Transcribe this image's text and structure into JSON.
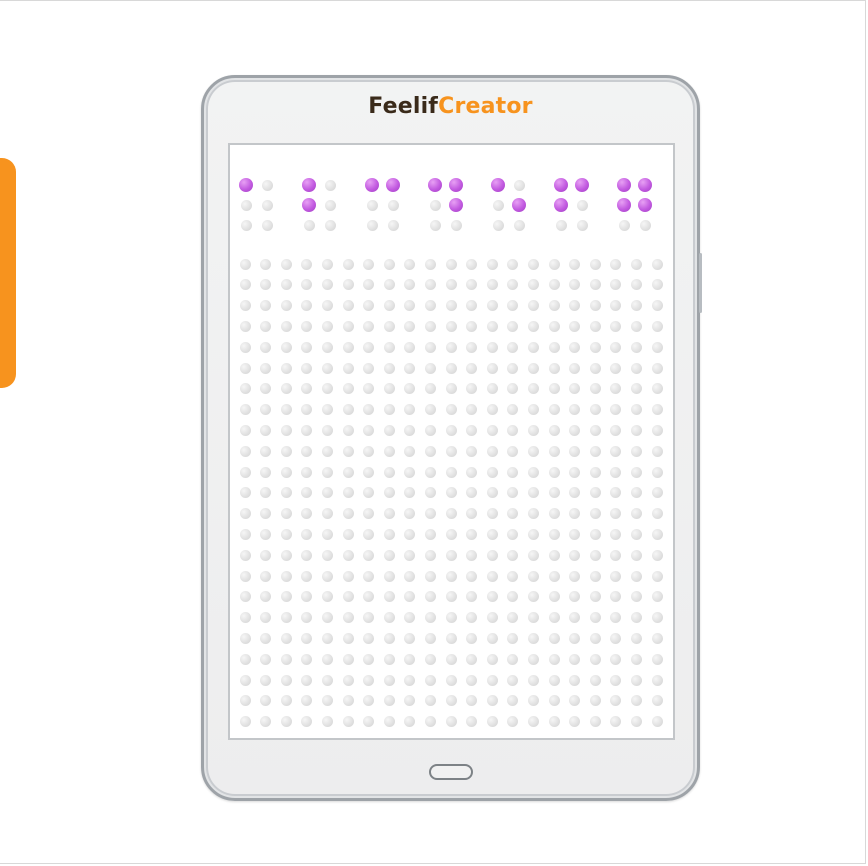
{
  "brand": {
    "name_part1": "Feelif",
    "name_part2": "Creator",
    "color_primary": "#3a2a1a",
    "color_accent": "#f7931e"
  },
  "device": {
    "type": "tablet",
    "frame_color": "#9ea3a8",
    "home_button_icon": "home-button-icon"
  },
  "braille_row": {
    "cells": [
      [
        1,
        0,
        0,
        0,
        0,
        0
      ],
      [
        1,
        0,
        1,
        0,
        0,
        0
      ],
      [
        1,
        1,
        0,
        0,
        0,
        0
      ],
      [
        1,
        1,
        0,
        1,
        0,
        0
      ],
      [
        1,
        0,
        0,
        1,
        0,
        0
      ],
      [
        1,
        1,
        1,
        0,
        0,
        0
      ],
      [
        1,
        1,
        1,
        1,
        0,
        0
      ]
    ],
    "dot_on_color": "#c25ae0",
    "dot_off_color": "#dcdcdc"
  },
  "dot_grid": {
    "rows": 23,
    "cols": 21
  }
}
